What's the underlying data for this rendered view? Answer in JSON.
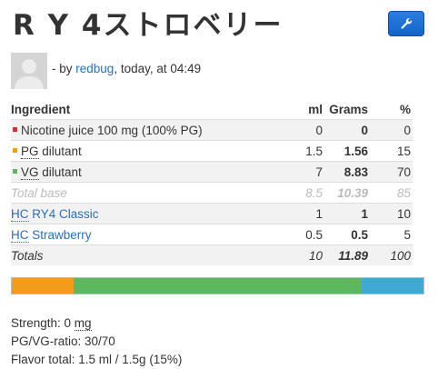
{
  "recipe": {
    "title": "R Y 4ストロベリー"
  },
  "byline": {
    "prefix": "- by ",
    "author": "redbug",
    "suffix": ", today, at 04:49"
  },
  "table": {
    "headers": {
      "ingredient": "Ingredient",
      "ml": "ml",
      "grams": "Grams",
      "pct": "%"
    },
    "rows": [
      {
        "name": "Nicotine juice 100 mg (100% PG)",
        "ml": "0",
        "grams": "0",
        "pct": "0",
        "color": "#cc3333"
      },
      {
        "abbr": "PG",
        "name": " dilutant",
        "ml": "1.5",
        "grams": "1.56",
        "pct": "15",
        "color": "#f39c1c"
      },
      {
        "abbr": "VG",
        "name": " dilutant",
        "ml": "7",
        "grams": "8.83",
        "pct": "70",
        "color": "#5cb85c"
      }
    ],
    "total_base": {
      "label": "Total base",
      "ml": "8.5",
      "grams": "10.39",
      "pct": "85"
    },
    "flavors": [
      {
        "abbr": "HC",
        "name": " RY4 Classic",
        "ml": "1",
        "grams": "1",
        "pct": "10"
      },
      {
        "abbr": "HC",
        "name": " Strawberry",
        "ml": "0.5",
        "grams": "0.5",
        "pct": "5"
      }
    ],
    "totals": {
      "label": "Totals",
      "ml": "10",
      "grams": "11.89",
      "pct": "100"
    }
  },
  "composition_bar": {
    "segments": [
      {
        "name": "PG",
        "percent": 15,
        "color": "#f39c1c"
      },
      {
        "name": "VG",
        "percent": 70,
        "color": "#5cb85c"
      },
      {
        "name": "Flavor",
        "percent": 15,
        "color": "#3fa9d4"
      }
    ]
  },
  "stats": {
    "strength_prefix": "Strength: 0 ",
    "strength_unit": "mg",
    "ratio": "PG/VG-ratio: 30/70",
    "flavor_total": "Flavor total: 1.5 ml / 1.5g (15%)"
  },
  "icons": {
    "edit": "wrench-icon",
    "avatar": "user-avatar-icon"
  }
}
